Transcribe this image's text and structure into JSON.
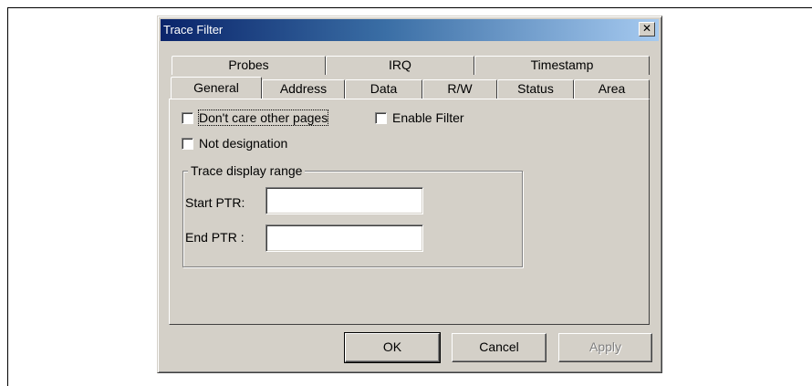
{
  "window": {
    "title": "Trace Filter",
    "close_glyph": "✕"
  },
  "tabs": {
    "row_back": [
      "Probes",
      "IRQ",
      "Timestamp"
    ],
    "row_front": [
      "General",
      "Address",
      "Data",
      "R/W",
      "Status",
      "Area"
    ],
    "active": "General"
  },
  "checkboxes": {
    "dont_care": {
      "label": "Don't care other pages",
      "checked": false
    },
    "enable_filter": {
      "label": "Enable Filter",
      "checked": false
    },
    "not_designation": {
      "label": "Not designation",
      "checked": false
    }
  },
  "group": {
    "legend": "Trace display range",
    "start_label": "Start PTR:",
    "start_value": "",
    "end_label": "End PTR :",
    "end_value": ""
  },
  "buttons": {
    "ok": "OK",
    "cancel": "Cancel",
    "apply": "Apply"
  }
}
